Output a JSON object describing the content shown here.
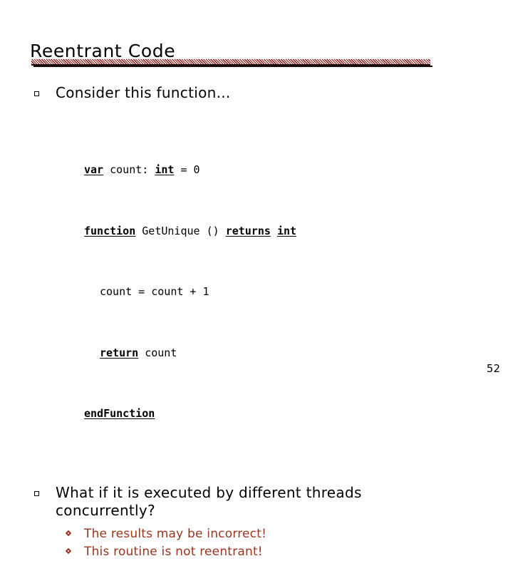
{
  "slide": {
    "title": "Reentrant Code",
    "page_number": "52",
    "accent_color": "#8a1616",
    "subbullet_color": "#9a3520",
    "text_color": "#000000"
  },
  "bullets": [
    {
      "marker": "hollow-square",
      "text": "Consider this function..."
    },
    {
      "marker": "hollow-square",
      "text": "What if it is executed by different threads concurrently?"
    }
  ],
  "code": {
    "lines": [
      {
        "indent": 0,
        "tokens": [
          {
            "text": "var",
            "keyword": true
          },
          {
            "text": " count: ",
            "keyword": false
          },
          {
            "text": "int",
            "keyword": true
          },
          {
            "text": " = 0",
            "keyword": false
          }
        ]
      },
      {
        "indent": 0,
        "tokens": [
          {
            "text": "function",
            "keyword": true
          },
          {
            "text": " GetUnique () ",
            "keyword": false
          },
          {
            "text": "returns",
            "keyword": true
          },
          {
            "text": " ",
            "keyword": false
          },
          {
            "text": "int",
            "keyword": true
          }
        ]
      },
      {
        "indent": 1,
        "tokens": [
          {
            "text": "count = count + 1",
            "keyword": false
          }
        ]
      },
      {
        "indent": 1,
        "tokens": [
          {
            "text": "return",
            "keyword": true
          },
          {
            "text": " count",
            "keyword": false
          }
        ]
      },
      {
        "indent": 0,
        "tokens": [
          {
            "text": "endFunction",
            "keyword": true
          }
        ]
      }
    ]
  },
  "subbullets": [
    {
      "marker": "diamond",
      "text": "The results may be incorrect!"
    },
    {
      "marker": "diamond",
      "text": "This routine is not reentrant!"
    }
  ]
}
